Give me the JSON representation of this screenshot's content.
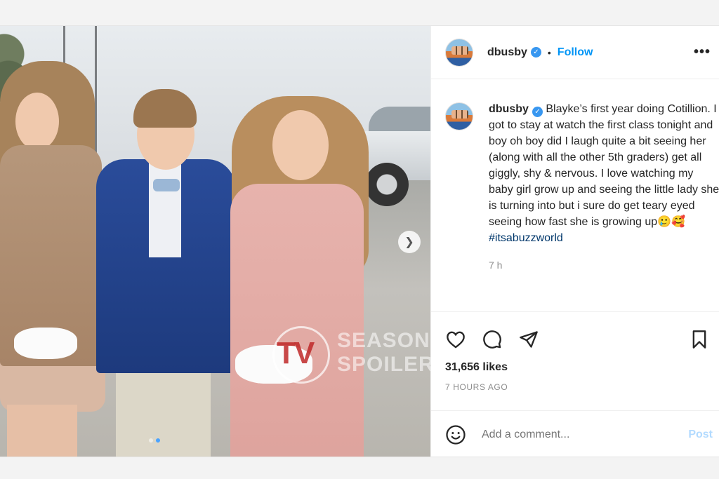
{
  "post": {
    "username": "dbusby",
    "follow_label": "Follow",
    "more_label": "•••",
    "separator": "•",
    "caption": "Blayke’s first year doing Cotillion. I got to stay at watch the first class tonight and boy oh boy did I laugh quite a bit seeing her (along with all the other 5th graders) get all giggly, shy & nervous. I love watching my baby girl grow up and seeing the little lady she is turning into but i sure do get teary eyed seeing how fast she is growing up🥲🥰",
    "hashtag": "#itsabuzzworld",
    "time_ago": "7 h",
    "likes": "31,656 likes",
    "posted": "7 HOURS AGO",
    "comment_placeholder": "Add a comment...",
    "post_label": "Post"
  },
  "watermark": {
    "logo": "TV",
    "line1": "SEASON",
    "line2": "SPOILER"
  },
  "icons": [
    "heart-icon",
    "comment-icon",
    "share-icon",
    "bookmark-icon",
    "emoji-icon",
    "chevron-right-icon",
    "verified-icon"
  ],
  "colors": {
    "link": "#0095f6",
    "hashtag": "#00376b",
    "verified": "#3897f0",
    "post_disabled": "#b3dbff",
    "muted": "#8e8e8e"
  },
  "carousel": {
    "slide_count": 2,
    "current_slide": 2
  }
}
